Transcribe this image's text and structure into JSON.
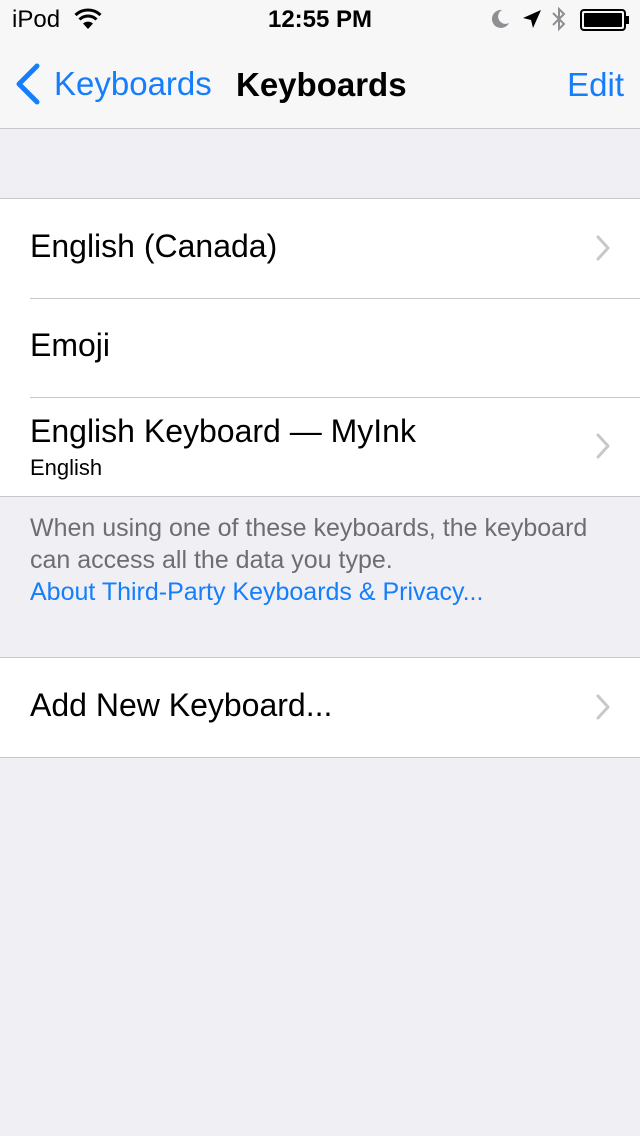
{
  "status_bar": {
    "carrier": "iPod",
    "time": "12:55 PM",
    "icons": [
      "wifi-icon",
      "moon-icon",
      "location-arrow-icon",
      "bluetooth-icon",
      "battery-icon"
    ]
  },
  "nav": {
    "back_label": "Keyboards",
    "title": "Keyboards",
    "edit_label": "Edit"
  },
  "keyboards": [
    {
      "label": "English (Canada)"
    },
    {
      "label": "Emoji"
    },
    {
      "label": "English Keyboard — MyInk",
      "sub": "English"
    }
  ],
  "footer": {
    "text": "When using one of these keyboards, the keyboard can access all the data you type.",
    "link": "About Third-Party Keyboards & Privacy..."
  },
  "add_keyboard": {
    "label": "Add New Keyboard..."
  },
  "colors": {
    "accent": "#157efb",
    "background": "#efeff4",
    "separator": "#c8c7cc",
    "footer_text": "#6d6d72"
  }
}
